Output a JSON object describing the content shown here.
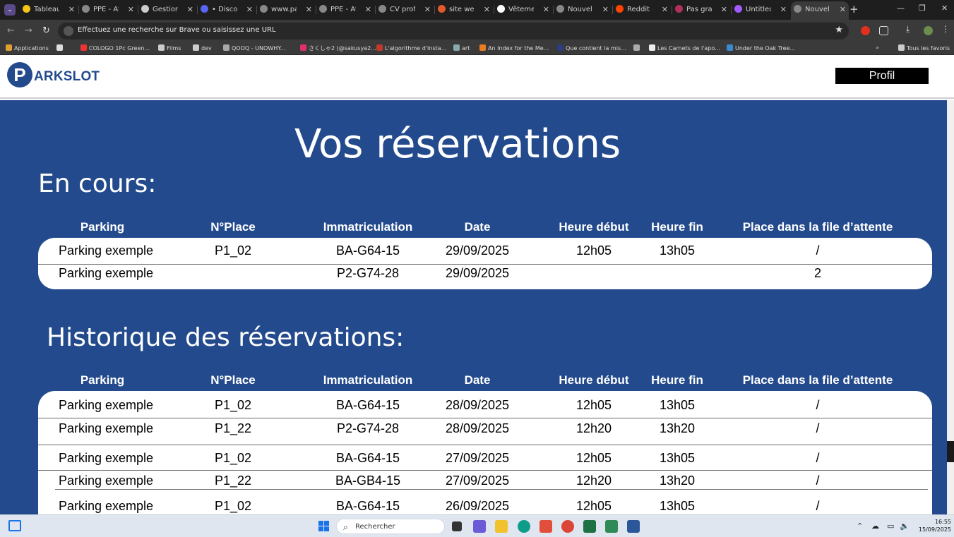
{
  "browser": {
    "tabs": [
      {
        "title": "Tableau",
        "favicon": "miro-icon",
        "color": "#f5c518"
      },
      {
        "title": "PPE - At",
        "favicon": "globe-icon",
        "color": "#888888"
      },
      {
        "title": "Gestion",
        "favicon": "chatgpt-icon",
        "color": "#cccccc"
      },
      {
        "title": "• Discord",
        "favicon": "discord-icon",
        "color": "#5865f2"
      },
      {
        "title": "www.par",
        "favicon": "globe-icon",
        "color": "#888888"
      },
      {
        "title": "PPE - At",
        "favicon": "globe-icon",
        "color": "#888888"
      },
      {
        "title": "CV profe",
        "favicon": "globe-icon",
        "color": "#888888"
      },
      {
        "title": "site web",
        "favicon": "brave-icon",
        "color": "#e05a2b"
      },
      {
        "title": "Vêtemen",
        "favicon": "b-icon",
        "color": "#ffffff"
      },
      {
        "title": "Nouvel o",
        "favicon": "globe-icon",
        "color": "#888888"
      },
      {
        "title": "Reddit -",
        "favicon": "reddit-icon",
        "color": "#ff4500"
      },
      {
        "title": "Pas grat",
        "favicon": "flower-icon",
        "color": "#b0305a"
      },
      {
        "title": "Untitled",
        "favicon": "figma-icon",
        "color": "#a259ff"
      },
      {
        "title": "Nouvel o",
        "favicon": "globe-icon",
        "color": "#888888",
        "active": true
      }
    ],
    "address_placeholder": "Effectuez une recherche sur Brave ou saisissez une URL",
    "bookmarks": [
      {
        "label": "Applications",
        "icon": "apps-icon",
        "color": "#e0a030"
      },
      {
        "label": "",
        "icon": "grid-icon",
        "color": "#dddddd"
      },
      {
        "label": "COLOGO 1Pc Green...",
        "icon": "cologo-icon",
        "color": "#e33"
      },
      {
        "label": "Films",
        "icon": "folder-icon",
        "color": "#cccccc"
      },
      {
        "label": "dev",
        "icon": "folder-icon",
        "color": "#cccccc"
      },
      {
        "label": "QOOQ - UNOWHY...",
        "icon": "globe-icon",
        "color": "#aaaaaa"
      },
      {
        "label": "さくしゃ2 (@sakusya2...",
        "icon": "instagram-icon",
        "color": "#e1306c"
      },
      {
        "label": "L'algorithme d'Insta...",
        "icon": "red-circle-icon",
        "color": "#c0392b"
      },
      {
        "label": "art",
        "icon": "art-icon",
        "color": "#8aa"
      },
      {
        "label": "An Index for the Me...",
        "icon": "index-icon",
        "color": "#e67e22"
      },
      {
        "label": "Que contient la mis...",
        "icon": "c-icon",
        "color": "#2c3e80"
      },
      {
        "label": "",
        "icon": "globe-icon",
        "color": "#aaaaaa"
      },
      {
        "label": "Les Carnets de l'apo...",
        "icon": "w-icon",
        "color": "#eeeeee"
      },
      {
        "label": "Under the Oak Tree...",
        "icon": "oak-icon",
        "color": "#3a8ad0"
      },
      {
        "label": "Tous les favoris",
        "icon": "folder-icon",
        "color": "#cccccc"
      }
    ]
  },
  "site": {
    "logo_letter": "P",
    "logo_text": "ARKSLOT",
    "profile_button": "Profil",
    "page_title": "Vos réservations",
    "current_section_title": "En cours:",
    "history_section_title": "Historique des réservations:",
    "columns": [
      "Parking",
      "N°Place",
      "Immatriculation",
      "Date",
      "Heure début",
      "Heure fin",
      "Place dans la file d’attente"
    ],
    "current_reservations": [
      {
        "parking": "Parking exemple",
        "place": "P1_02",
        "plate": "BA-G64-15",
        "date": "29/09/2025",
        "start": "12h05",
        "end": "13h05",
        "queue": "/"
      },
      {
        "parking": "Parking exemple",
        "place": "",
        "plate": "P2-G74-28",
        "date": "29/09/2025",
        "start": "",
        "end": "",
        "queue": "2"
      }
    ],
    "history_reservations": [
      {
        "parking": "Parking exemple",
        "place": "P1_02",
        "plate": "BA-G64-15",
        "date": "28/09/2025",
        "start": "12h05",
        "end": "13h05",
        "queue": "/"
      },
      {
        "parking": "Parking exemple",
        "place": "P1_22",
        "plate": "P2-G74-28",
        "date": "28/09/2025",
        "start": "12h20",
        "end": "13h20",
        "queue": "/"
      },
      {
        "parking": "Parking exemple",
        "place": "P1_02",
        "plate": "BA-G64-15",
        "date": "27/09/2025",
        "start": "12h05",
        "end": "13h05",
        "queue": "/"
      },
      {
        "parking": "Parking exemple",
        "place": "P1_22",
        "plate": "BA-GB4-15",
        "date": "27/09/2025",
        "start": "12h20",
        "end": "13h20",
        "queue": "/"
      },
      {
        "parking": "Parking exemple",
        "place": "P1_02",
        "plate": "BA-G64-15",
        "date": "26/09/2025",
        "start": "12h05",
        "end": "13h05",
        "queue": "/"
      }
    ]
  },
  "taskbar": {
    "search_placeholder": "Rechercher",
    "time": "16:55",
    "date": "15/09/2025"
  }
}
